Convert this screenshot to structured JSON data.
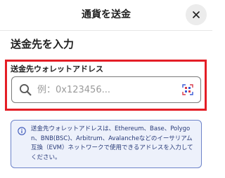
{
  "header": {
    "title": "通貨を送金",
    "close_icon": "close-icon"
  },
  "section": {
    "title": "送金先を入力"
  },
  "address_field": {
    "label": "送金先ウォレットアドレス",
    "value": "",
    "placeholder": "例：0x123456...",
    "search_icon": "search-icon",
    "qr_icon": "qr-scan-icon"
  },
  "info": {
    "icon": "info-icon",
    "text": "送金先ウォレットアドレスは、Ethereum、Base、Polygon、BNB(BSC)、Arbitrum、Avalancheなどのイーサリアム互換（EVM）ネットワークで使用できるアドレスを入力してください。"
  },
  "colors": {
    "highlight_border": "#e41e26",
    "info_border": "#6d83c9",
    "info_background": "#edf1fb",
    "info_text": "#283a78"
  }
}
